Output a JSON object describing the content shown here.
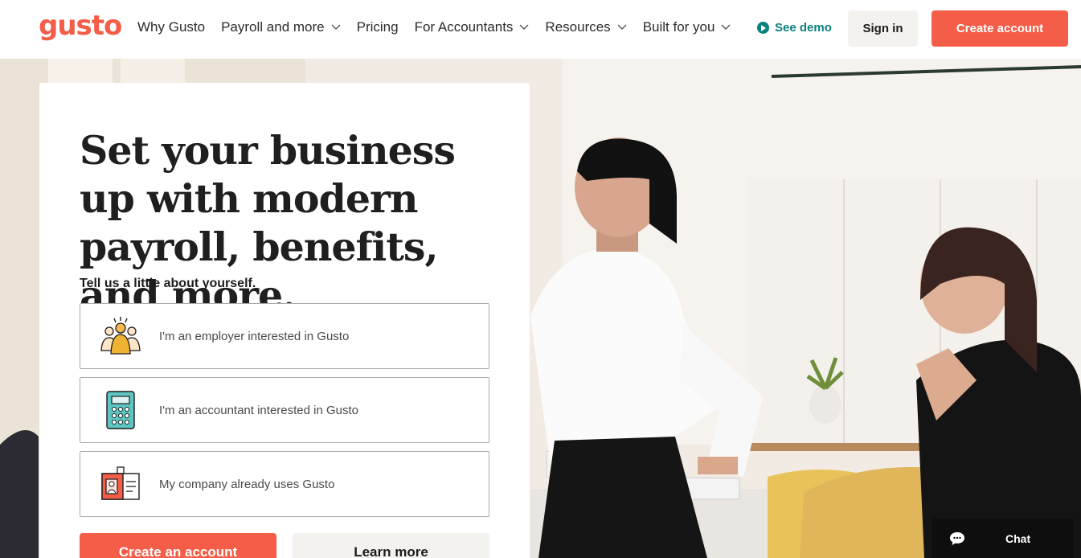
{
  "brand": {
    "logo_text": "gusto",
    "accent_color": "#f45d48",
    "teal_color": "#0a8080"
  },
  "nav": {
    "items": [
      {
        "label": "Why Gusto",
        "has_dropdown": false
      },
      {
        "label": "Payroll and more",
        "has_dropdown": true
      },
      {
        "label": "Pricing",
        "has_dropdown": false
      },
      {
        "label": "For Accountants",
        "has_dropdown": true
      },
      {
        "label": "Resources",
        "has_dropdown": true
      },
      {
        "label": "Built for you",
        "has_dropdown": true
      }
    ],
    "demo_label": "See demo",
    "signin_label": "Sign in",
    "create_label": "Create account"
  },
  "hero": {
    "headline": "Set your business up with modern payroll, benefits, and more.",
    "subhead": "Tell us a little about yourself.",
    "options": [
      {
        "label": "I'm an employer interested in Gusto",
        "icon": "employer-group-icon"
      },
      {
        "label": "I'm an accountant interested in Gusto",
        "icon": "calculator-icon"
      },
      {
        "label": "My company already uses Gusto",
        "icon": "id-badge-icon"
      }
    ],
    "primary_button": "Create an account",
    "secondary_button": "Learn more"
  },
  "chat": {
    "label": "Chat"
  }
}
